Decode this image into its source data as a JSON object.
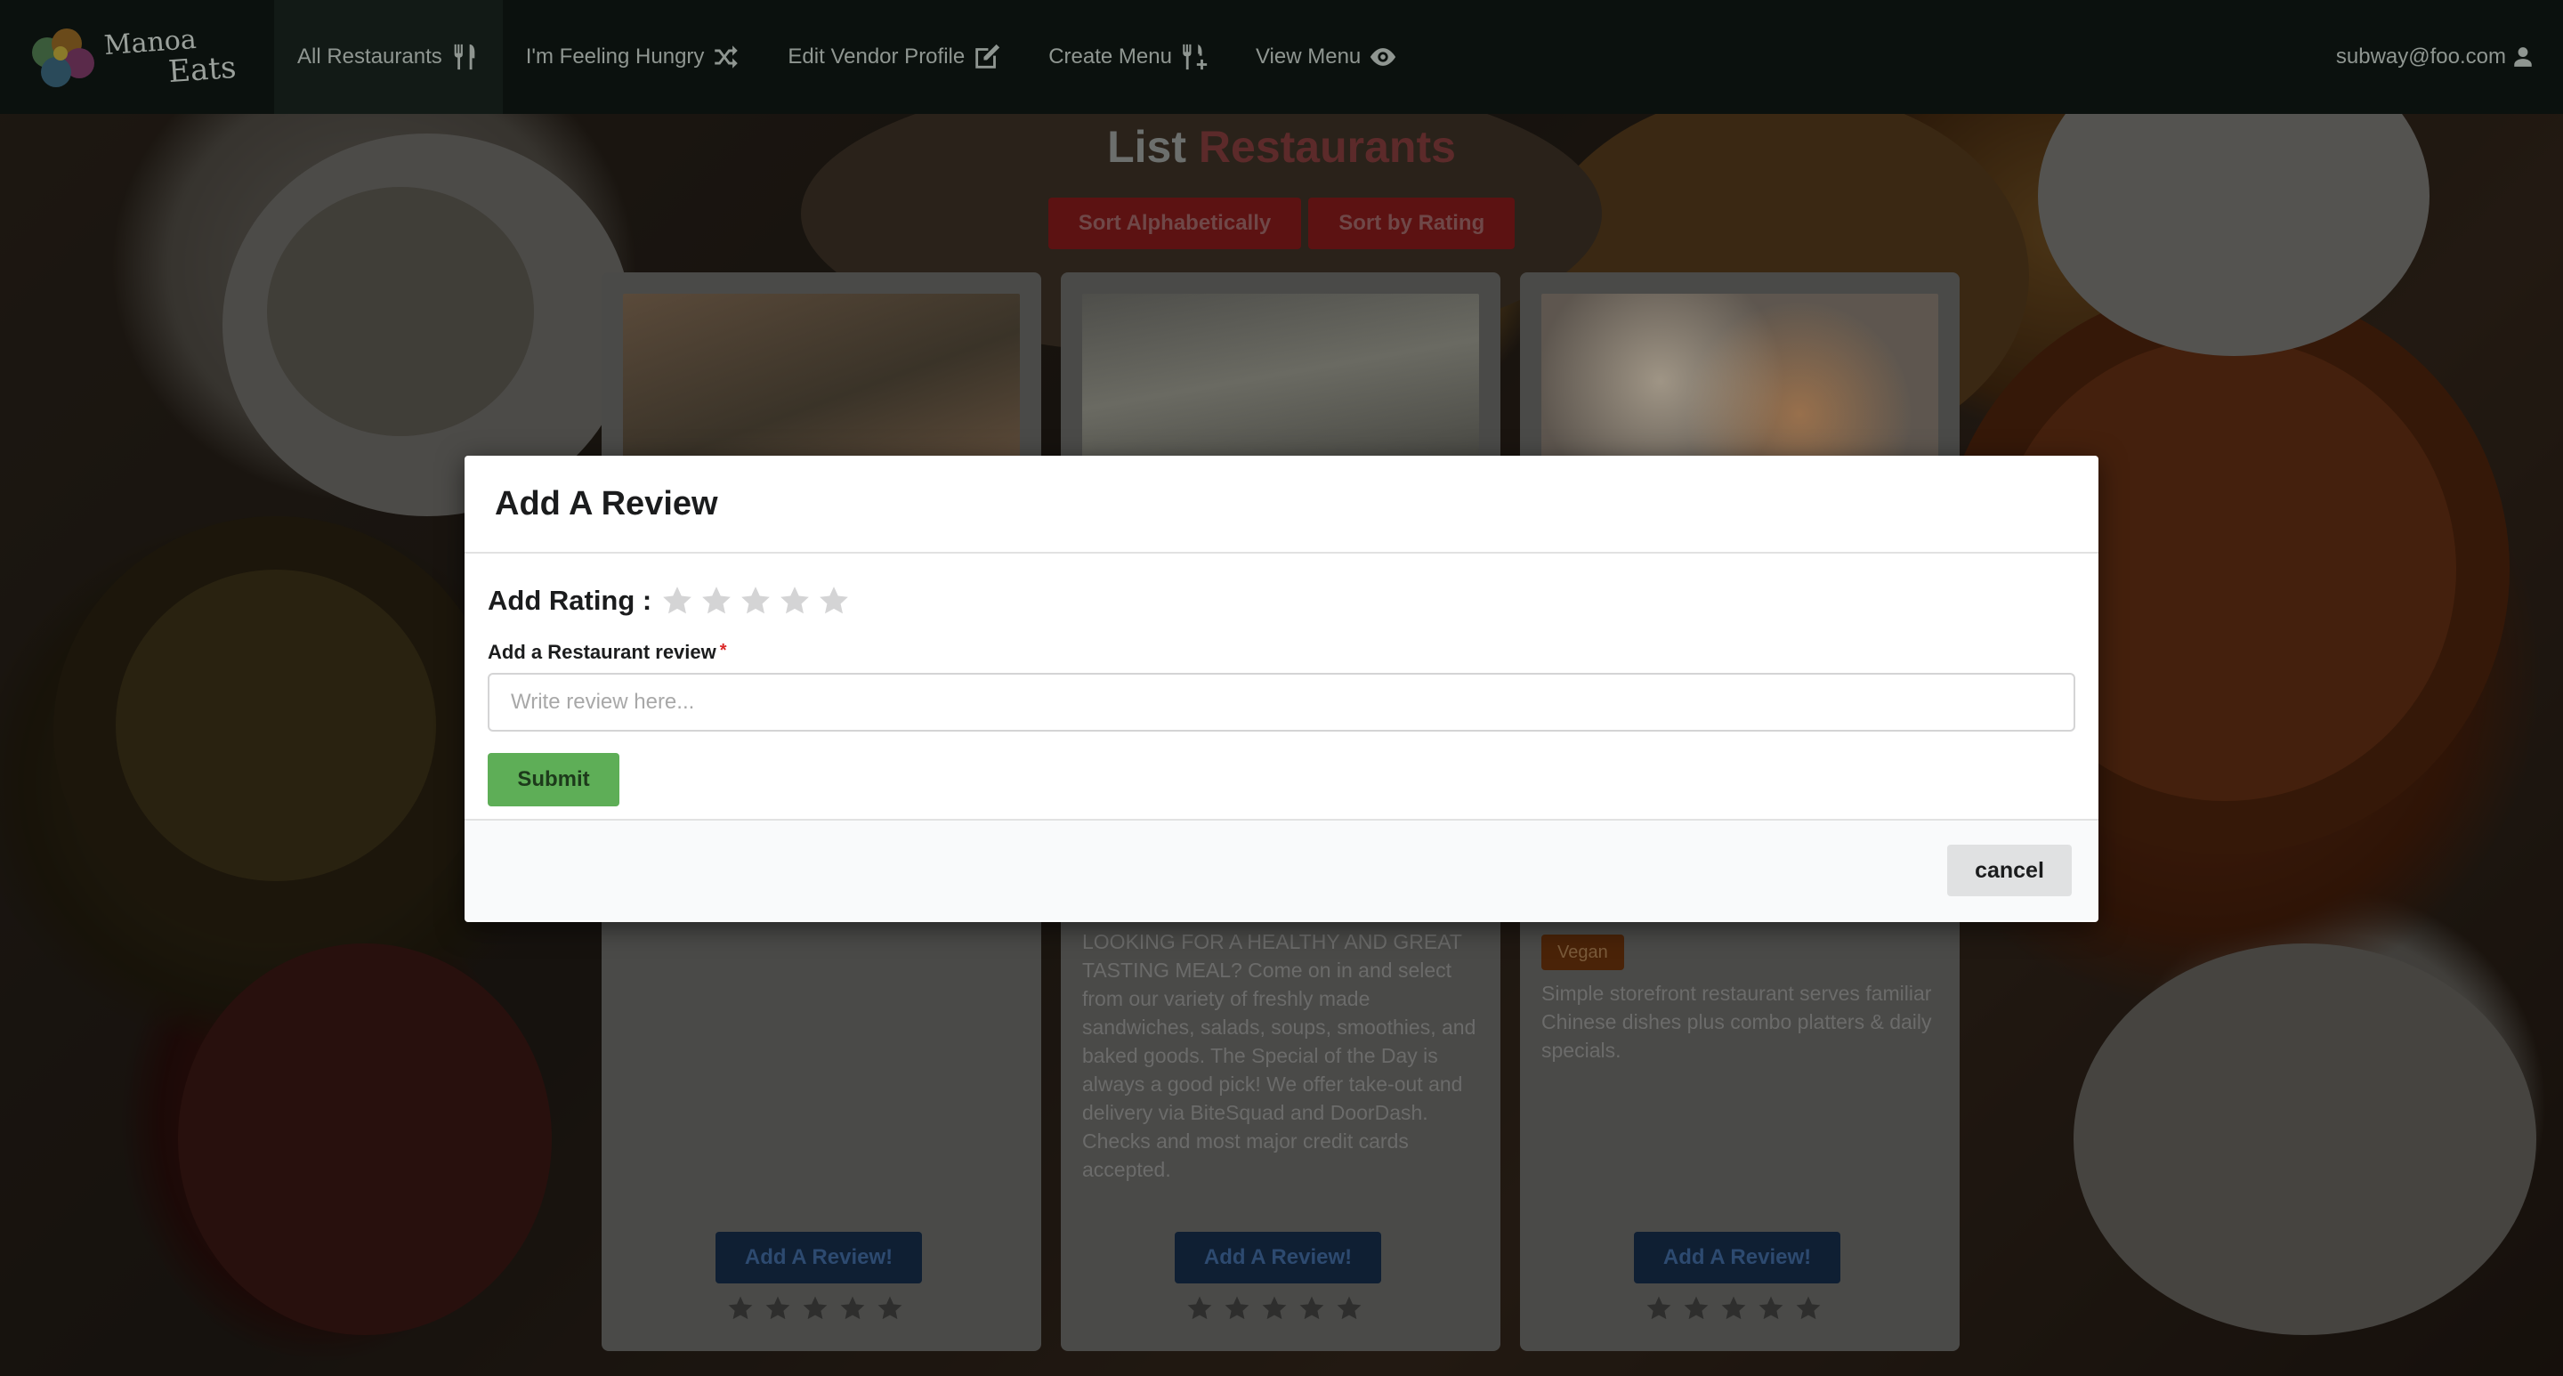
{
  "brand": {
    "line1": "Manoa",
    "line2": "Eats"
  },
  "nav": {
    "items": [
      {
        "label": "All Restaurants",
        "icon": "utensils-icon"
      },
      {
        "label": "I'm Feeling Hungry",
        "icon": "shuffle-icon"
      },
      {
        "label": "Edit Vendor Profile",
        "icon": "edit-icon"
      },
      {
        "label": "Create Menu",
        "icon": "utensils-plus-icon"
      },
      {
        "label": "View Menu",
        "icon": "eye-icon"
      }
    ],
    "user": "subway@foo.com"
  },
  "page": {
    "title_part1": "List",
    "title_part2": "Restaurants",
    "sort_alpha": "Sort Alphabetically",
    "sort_rating": "Sort by Rating"
  },
  "cards": [
    {
      "tags": [],
      "description": "",
      "review_button": "Add A Review!"
    },
    {
      "tags": [],
      "description": "LOOKING FOR A HEALTHY AND GREAT TASTING MEAL? Come on in and select from our variety of freshly made sandwiches, salads, soups, smoothies, and baked goods. The Special of the Day is always a good pick! We offer take-out and delivery via BiteSquad and DoorDash. Checks and most major credit cards accepted.",
      "review_button": "Add A Review!"
    },
    {
      "tags": [
        "Vegan"
      ],
      "description": "Simple storefront restaurant serves familiar Chinese dishes plus combo platters & daily specials.",
      "review_button": "Add A Review!"
    }
  ],
  "modal": {
    "title": "Add A Review",
    "rating_label": "Add Rating :",
    "rating_value": 0,
    "rating_max": 5,
    "review_label": "Add a Restaurant review",
    "required_marker": "*",
    "review_placeholder": "Write review here...",
    "review_value": "",
    "submit": "Submit",
    "cancel": "cancel"
  },
  "colors": {
    "submit": "#5eae57",
    "required": "#db2828",
    "star_empty": "#d4d4d5"
  }
}
